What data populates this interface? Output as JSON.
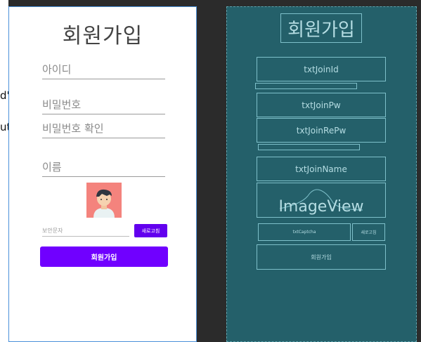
{
  "code_snippet": {
    "line1": "d\"",
    "line2": "uto\""
  },
  "design": {
    "title": "회원가입",
    "fields": {
      "id": "아이디",
      "pw": "비밀번호",
      "repw": "비밀번호 확인",
      "name": "이름"
    },
    "captcha_placeholder": "보안문자",
    "refresh_label": "새로고침",
    "join_button": "회원가입"
  },
  "blueprint": {
    "title": "회원가입",
    "join_id": "txtJoinId",
    "join_pw": "txtJoinPw",
    "join_repw": "txtJoinRePw",
    "join_name": "txtJoinName",
    "image_view": "ImageView",
    "captcha": "txtCaptcha",
    "refresh": "새로고침",
    "join_button": "회원가입"
  }
}
